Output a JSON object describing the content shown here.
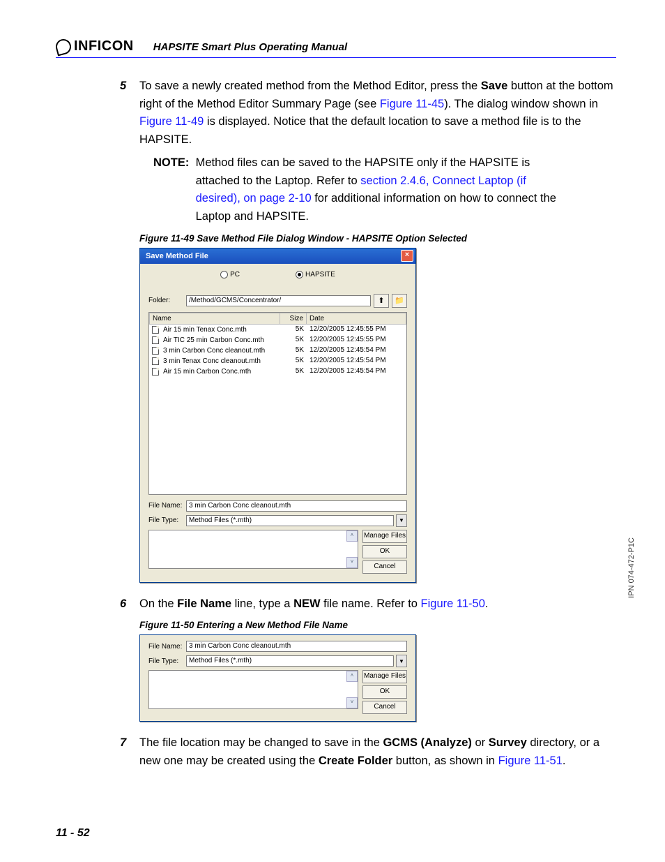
{
  "header": {
    "logo_text": "INFICON",
    "doc_title": "HAPSITE Smart Plus Operating Manual"
  },
  "step5": {
    "num": "5",
    "para1_a": "To save a newly created method from the Method Editor, press the ",
    "save_bold": "Save",
    "para1_b": " button at the bottom right of the Method Editor Summary Page (see ",
    "fig_link1": "Figure 11-45",
    "para1_c": "). The dialog window shown in ",
    "fig_link2": "Figure 11-49",
    "para1_d": " is displayed. Notice that the default location to save a method file is to the HAPSITE.",
    "note_label": "NOTE:",
    "note_a": "Method files can be saved to the HAPSITE only if the HAPSITE is attached to the Laptop. Refer to ",
    "note_link": "section 2.4.6, Connect Laptop (if desired), on page 2-10",
    "note_b": " for additional information on how to connect the Laptop and HAPSITE."
  },
  "fig49_caption": "Figure 11-49  Save Method File Dialog Window - HAPSITE Option Selected",
  "dialog": {
    "title": "Save Method File",
    "radio_pc": "PC",
    "radio_hapsite": "HAPSITE",
    "folder_label": "Folder:",
    "folder_value": "/Method/GCMS/Concentrator/",
    "col_name": "Name",
    "col_size": "Size",
    "col_date": "Date",
    "files": [
      {
        "name": "Air 15 min Tenax Conc.mth",
        "size": "5K",
        "date": "12/20/2005 12:45:55 PM"
      },
      {
        "name": "Air TIC 25 min Carbon Conc.mth",
        "size": "5K",
        "date": "12/20/2005 12:45:55 PM"
      },
      {
        "name": "3 min Carbon Conc cleanout.mth",
        "size": "5K",
        "date": "12/20/2005 12:45:54 PM"
      },
      {
        "name": "3 min Tenax Conc cleanout.mth",
        "size": "5K",
        "date": "12/20/2005 12:45:54 PM"
      },
      {
        "name": "Air 15 min Carbon Conc.mth",
        "size": "5K",
        "date": "12/20/2005 12:45:54 PM"
      }
    ],
    "filename_label": "File Name:",
    "filename_value": "3 min Carbon Conc cleanout.mth",
    "filetype_label": "File Type:",
    "filetype_value": "Method Files (*.mth)",
    "btn_manage": "Manage Files",
    "btn_ok": "OK",
    "btn_cancel": "Cancel"
  },
  "step6": {
    "num": "6",
    "a": "On the ",
    "b1": "File Name",
    "b": " line, type a ",
    "b2": "NEW",
    "c": " file name. Refer to ",
    "link": "Figure 11-50",
    "d": "."
  },
  "fig50_caption": "Figure 11-50  Entering a New Method File Name",
  "step7": {
    "num": "7",
    "a": "The file location may be changed to save in the ",
    "b1": "GCMS (Analyze)",
    "b": " or ",
    "b2": "Survey",
    "c": " directory, or a new one may be created using the ",
    "b3": "Create Folder",
    "d": " button, as shown in ",
    "link": "Figure 11-51",
    "e": "."
  },
  "page_number": "11 - 52",
  "side_text": "IPN 074-472-P1C"
}
